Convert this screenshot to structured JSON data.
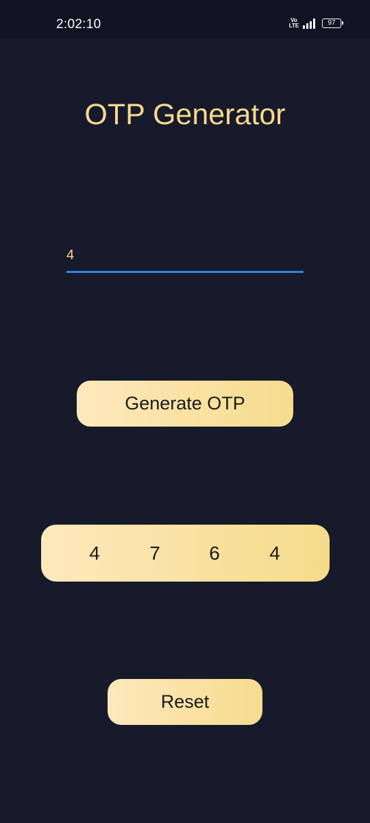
{
  "status_bar": {
    "time": "2:02:10",
    "volte_top": "Vo",
    "volte_bottom": "LTE",
    "battery": "97"
  },
  "app": {
    "title": "OTP Generator"
  },
  "input": {
    "value": "4"
  },
  "buttons": {
    "generate_label": "Generate OTP",
    "reset_label": "Reset"
  },
  "otp": {
    "digits": [
      "4",
      "7",
      "6",
      "4"
    ]
  },
  "colors": {
    "background": "#171a2b",
    "accent_text": "#f7d98c",
    "input_underline": "#2f86e0",
    "button_gradient_start": "#fde8bc",
    "button_gradient_end": "#f6dc8e"
  },
  "icons": {
    "volte": "volte-icon",
    "signal": "signal-icon",
    "battery": "battery-icon"
  }
}
